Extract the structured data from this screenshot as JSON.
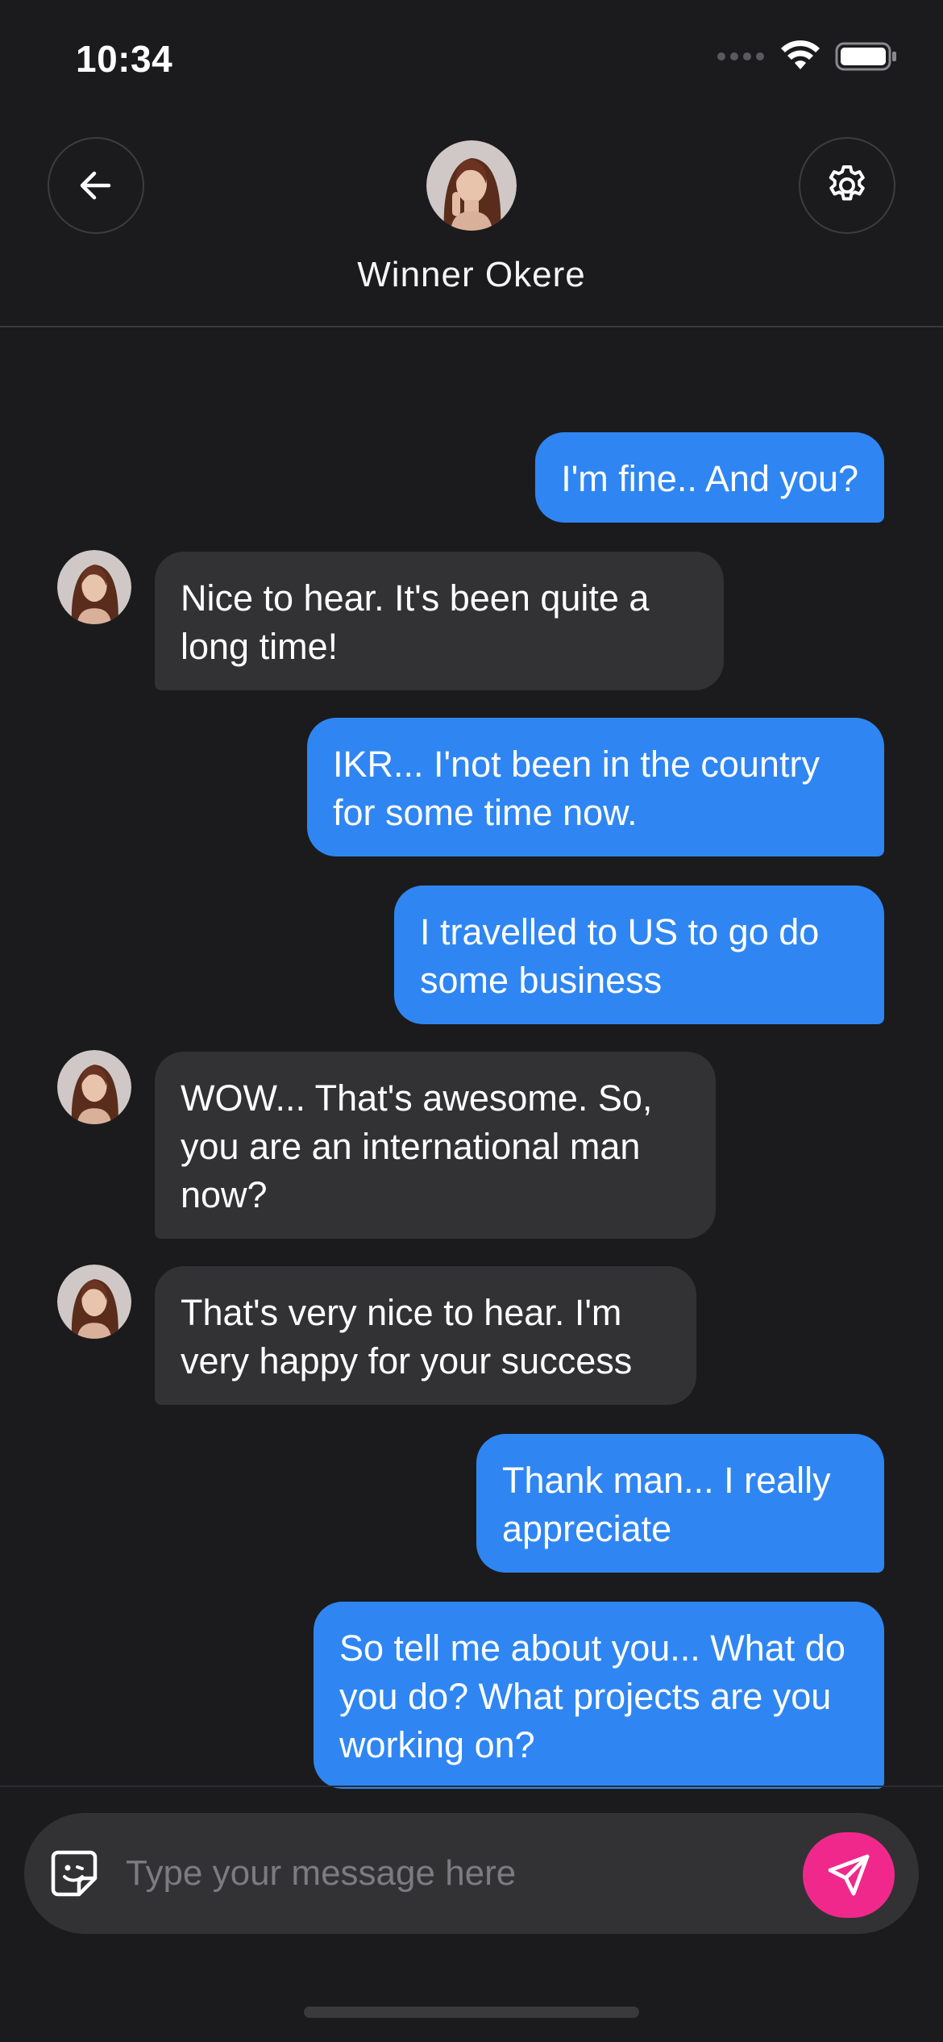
{
  "status_bar": {
    "time": "10:34"
  },
  "header": {
    "contact_name": "Winner Okere",
    "back_icon": "arrow-left-icon",
    "settings_icon": "gear-icon"
  },
  "messages": [
    {
      "direction": "out",
      "text": "I'm fine.. And you?"
    },
    {
      "direction": "in",
      "text": "Nice to hear. It's been quite a long time!"
    },
    {
      "direction": "out",
      "text": "IKR... I'not been in the country for some time now."
    },
    {
      "direction": "out",
      "text": "I travelled to US to go do some business"
    },
    {
      "direction": "in",
      "text": "WOW... That's awesome. So, you are an international man now?"
    },
    {
      "direction": "in",
      "text": "That's very nice to hear. I'm very happy for your success"
    },
    {
      "direction": "out",
      "text": "Thank man... I really appreciate"
    },
    {
      "direction": "out",
      "text": "So tell me about you... What do you do? What projects are you working on?"
    }
  ],
  "composer": {
    "placeholder": "Type your message here",
    "value": "",
    "send_icon": "send-icon",
    "emoji_icon": "sticker-icon"
  },
  "colors": {
    "background": "#1b1b1d",
    "outgoing_bubble": "#2f86f2",
    "incoming_bubble": "#323235",
    "send_button": "#f1288c"
  }
}
